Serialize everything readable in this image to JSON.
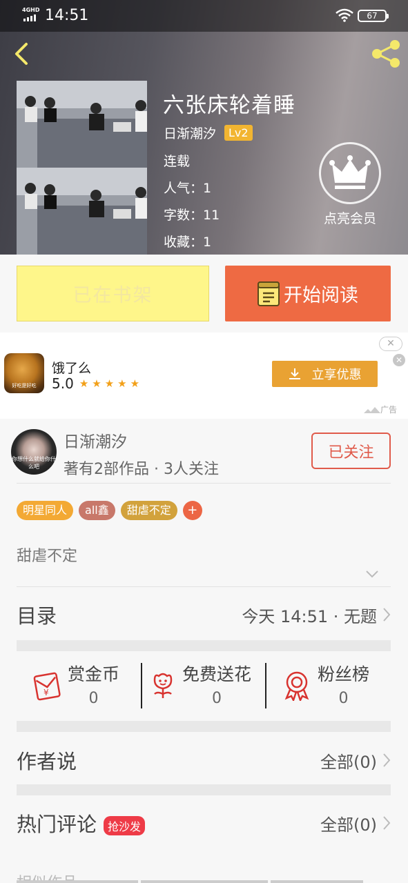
{
  "status_bar": {
    "network": "4GHD",
    "time": "14:51",
    "battery": "67"
  },
  "book": {
    "title": "六张床轮着睡",
    "author": "日渐潮汐",
    "level": "Lv2",
    "status": "连载",
    "popularity": "人气：1",
    "word_count": "字数：11",
    "favorites": "收藏：1"
  },
  "vip": {
    "label": "点亮会员"
  },
  "actions": {
    "shelf_label": "已在书架",
    "read_label": "开始阅读"
  },
  "ad": {
    "app_name": "饿了么",
    "rating": "5.0",
    "stars": "★★★★★",
    "cta": "立享优惠",
    "close_oval": "✕",
    "close_dot": "✕",
    "mark": "广告",
    "thumb_text": "好吃是好吃"
  },
  "author_card": {
    "name": "日渐潮汐",
    "stats": "著有2部作品 · 3人关注",
    "follow_label": "已关注",
    "avatar_text": "你想什么就给你什么吧"
  },
  "tags": [
    {
      "label": "明星同人",
      "color": "#f3a934"
    },
    {
      "label": "all鑫",
      "color": "#c8786a"
    },
    {
      "label": "甜虐不定",
      "color": "#d2a23c"
    },
    {
      "label": "+",
      "color": "#ec6645"
    }
  ],
  "description": "甜虐不定",
  "catalog": {
    "title": "目录",
    "latest": "今天 14:51 · 无题"
  },
  "stats": [
    {
      "label": "赏金币",
      "value": "0",
      "icon": "red-envelope-icon"
    },
    {
      "label": "免费送花",
      "value": "0",
      "icon": "flower-icon"
    },
    {
      "label": "粉丝榜",
      "value": "0",
      "icon": "medal-icon"
    }
  ],
  "author_says": {
    "title": "作者说",
    "all": "全部(0)"
  },
  "hot_comments": {
    "title": "热门评论",
    "badge": "抢沙发",
    "all": "全部(0)"
  },
  "similar": {
    "title": "相似作品"
  },
  "colors": {
    "accent_red": "#ee6a43",
    "shelf_yellow": "#fef68a",
    "ad_orange": "#e9a233",
    "follow_red": "#e05a4a",
    "level_badge": "#f2b531"
  }
}
